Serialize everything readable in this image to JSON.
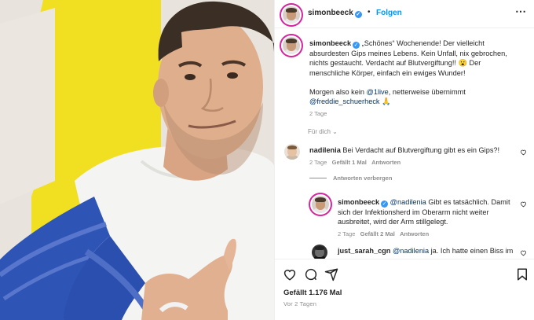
{
  "header": {
    "username": "simonbeeck",
    "separator": "•",
    "follow_label": "Folgen",
    "more_icon": "more-horizontal-icon"
  },
  "caption": {
    "username": "simonbeeck",
    "line1": "„Schönes“ Wochenende! Der vielleicht",
    "line2": "absurdesten Gips meines Lebens. Kein Unfall, nix gebrochen,",
    "line3": "nichts gestaucht. Verdacht auf Blutvergiftung!! 😮 Der",
    "line4": "menschliche Körper, einfach ein ewiges Wunder!",
    "line5_pre": "Morgen also kein ",
    "line5_mention": "@1live",
    "line5_post": ", netterweise übernimmt",
    "line6_mention": "@freddie_schuerheck",
    "line6_emoji": "🙏",
    "time": "2 Tage",
    "see_translation": "Für dich"
  },
  "comments": [
    {
      "username": "nadilenia",
      "text": "Bei Verdacht auf Blutvergiftung gibt es ein Gips?!",
      "time": "2 Tage",
      "likes": "Gefällt 1 Mal",
      "reply": "Antworten"
    }
  ],
  "hide_replies": "Antworten verbergen",
  "replies": [
    {
      "username": "simonbeeck",
      "mention": "@nadilenia",
      "line1": " Gibt es tatsächlich. Damit",
      "line2": "sich der Infektionsherd im Oberarm nicht weiter",
      "line3": "ausbreitet, wird der Arm stillgelegt.",
      "time": "2 Tage",
      "likes": "Gefällt 2 Mal",
      "reply": "Antworten"
    },
    {
      "username": "just_sarah_cgn",
      "mention": "@nadilenia",
      "text": " ja. Ich hatte einen Biss im"
    }
  ],
  "footer": {
    "likes": "Gefällt 1.176 Mal",
    "time": "Vor 2 Tagen"
  },
  "colors": {
    "accent_blue": "#0095f6",
    "mention_blue": "#00376b",
    "muted": "#8e8e8e",
    "text": "#262626",
    "sleeve": "#2f55b8",
    "wall_yellow": "#f2e226"
  }
}
